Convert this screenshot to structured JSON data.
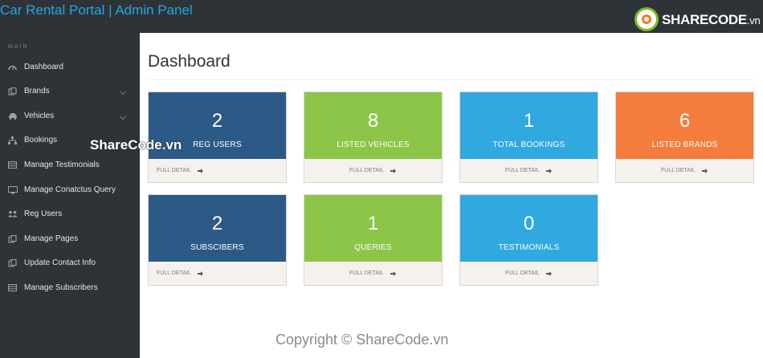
{
  "header": {
    "title": "Car Rental Portal | Admin Panel"
  },
  "watermark_logo": {
    "brand": "SHARECODE",
    "suffix": ".vn"
  },
  "sidebar": {
    "section_label": "MAIN",
    "items": [
      {
        "label": "Dashboard",
        "icon": "dashboard-icon",
        "has_submenu": false
      },
      {
        "label": "Brands",
        "icon": "files-icon",
        "has_submenu": true
      },
      {
        "label": "Vehicles",
        "icon": "car-icon",
        "has_submenu": true
      },
      {
        "label": "Bookings",
        "icon": "sitemap-icon",
        "has_submenu": false
      },
      {
        "label": "Manage Testimonials",
        "icon": "table-icon",
        "has_submenu": false
      },
      {
        "label": "Manage Conatctus Query",
        "icon": "desktop-icon",
        "has_submenu": false
      },
      {
        "label": "Reg Users",
        "icon": "users-icon",
        "has_submenu": false
      },
      {
        "label": "Manage Pages",
        "icon": "files-icon",
        "has_submenu": false
      },
      {
        "label": "Update Contact Info",
        "icon": "files-icon",
        "has_submenu": false
      },
      {
        "label": "Manage Subscribers",
        "icon": "table-icon",
        "has_submenu": false
      }
    ]
  },
  "main": {
    "page_title": "Dashboard",
    "cards": [
      {
        "value": "2",
        "label": "REG USERS",
        "detail": "FULL DETAIL",
        "color": "#2c5a87"
      },
      {
        "value": "8",
        "label": "LISTED VEHICLES",
        "detail": "FULL DETAIL",
        "color": "#8dc549"
      },
      {
        "value": "1",
        "label": "TOTAL BOOKINGS",
        "detail": "FULL DETAIL",
        "color": "#30a8e0"
      },
      {
        "value": "6",
        "label": "LISTED BRANDS",
        "detail": "FULL DETAIL",
        "color": "#f47c3c"
      },
      {
        "value": "2",
        "label": "SUBSCIBERS",
        "detail": "FULL DETAIL",
        "color": "#2c5a87"
      },
      {
        "value": "1",
        "label": "QUERIES",
        "detail": "FULL DETAIL",
        "color": "#8dc549"
      },
      {
        "value": "0",
        "label": "TESTIMONIALS",
        "detail": "FULL DETAIL",
        "color": "#30a8e0"
      }
    ]
  },
  "watermarks": {
    "overlay": "ShareCode.vn",
    "footer": "Copyright © ShareCode.vn"
  }
}
